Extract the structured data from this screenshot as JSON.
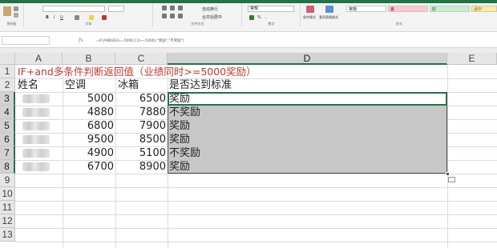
{
  "ribbon": {
    "accent": "#217346",
    "clipboard_label": "剪贴板",
    "font_label": "字体",
    "alignment_label": "对齐方式",
    "number_label": "数字",
    "styles_label": "样式",
    "number_format": "常规",
    "wrap_text": "自动换行",
    "merge_center": "合并后居中",
    "conditional_format": "条件格式",
    "table_format": "套用表格格式",
    "cell_style_bad": "差",
    "cell_style_good": "好",
    "cell_style_normal": "常规",
    "cell_style_neutral": "适中"
  },
  "formula_bar": {
    "fx": "fx",
    "formula": "=IF(AND(B3>=5000,C3>=5000),\"奖励\",\"不奖励\")"
  },
  "columns": [
    "A",
    "B",
    "C",
    "D",
    "E"
  ],
  "rows": [
    "1",
    "2",
    "3",
    "4",
    "5",
    "6",
    "7",
    "8",
    "9",
    "10",
    "11",
    "12",
    "13"
  ],
  "sheet": {
    "title": "IF+and多条件判断返回值（业绩同时>=5000奖励）",
    "headers": {
      "name": "姓名",
      "ac": "空调",
      "fridge": "冰箱",
      "reached": "是否达到标准"
    },
    "data_rows": [
      {
        "ac": "5000",
        "fridge": "6500",
        "result": "奖励"
      },
      {
        "ac": "4880",
        "fridge": "7880",
        "result": "不奖励"
      },
      {
        "ac": "6800",
        "fridge": "7900",
        "result": "奖励"
      },
      {
        "ac": "9500",
        "fridge": "8500",
        "result": "奖励"
      },
      {
        "ac": "4900",
        "fridge": "5100",
        "result": "不奖励"
      },
      {
        "ac": "6700",
        "fridge": "8900",
        "result": "奖励"
      }
    ]
  }
}
